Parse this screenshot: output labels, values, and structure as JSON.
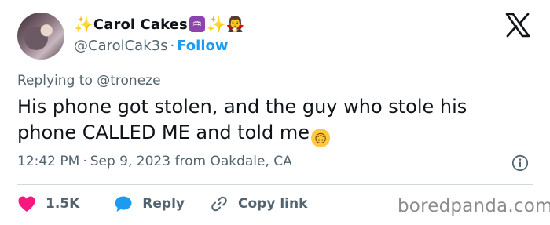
{
  "colors": {
    "accent": "#1d9bf0",
    "heart": "#f91880",
    "text": "#0f1419",
    "muted": "#536471"
  },
  "author": {
    "display_name": "Carol Cakes",
    "handle": "@CarolCak3s",
    "separator": "·",
    "follow_label": "Follow",
    "avatar_icon": "profile-photo",
    "name_decorations": [
      "sparkles-emoji",
      "aquarius-emoji",
      "sparkles-emoji",
      "vampire-emoji"
    ]
  },
  "brand_icon": "x-logo-icon",
  "reply_context": {
    "prefix": "Replying to",
    "mention": "@troneze"
  },
  "tweet": {
    "text": "His phone got stolen, and the guy who stole his phone CALLED ME and told me",
    "trailing_emoji": "upside-down-face-emoji"
  },
  "meta": {
    "time": "12:42 PM",
    "separator": "·",
    "date": "Sep 9, 2023",
    "location": "from Oakdale, CA",
    "info_icon": "info-icon"
  },
  "actions": {
    "like": {
      "icon": "heart-icon",
      "count": "1.5K"
    },
    "reply": {
      "icon": "reply-bubble-icon",
      "label": "Reply"
    },
    "copy_link": {
      "icon": "link-icon",
      "label": "Copy link"
    }
  },
  "watermark": "boredpanda.com"
}
